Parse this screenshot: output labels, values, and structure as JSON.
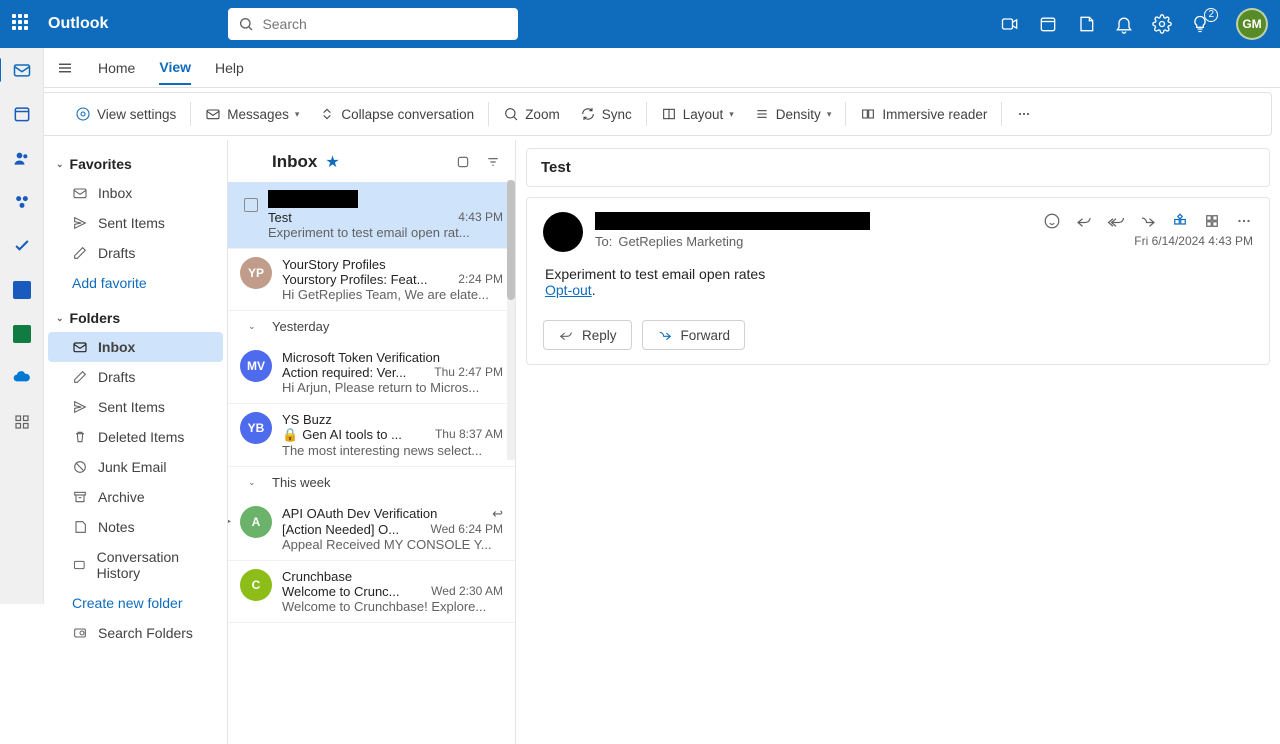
{
  "brand": "Outlook",
  "search_placeholder": "Search",
  "avatar_initials": "GM",
  "notif_badge": "2",
  "tabs": {
    "home": "Home",
    "view": "View",
    "help": "Help"
  },
  "toolbar": {
    "view_settings": "View settings",
    "messages": "Messages",
    "collapse": "Collapse conversation",
    "zoom": "Zoom",
    "sync": "Sync",
    "layout": "Layout",
    "density": "Density",
    "immersive": "Immersive reader"
  },
  "folders": {
    "favorites": "Favorites",
    "folders": "Folders",
    "items": {
      "inbox": "Inbox",
      "sent": "Sent Items",
      "drafts": "Drafts",
      "addfav": "Add favorite",
      "deleted": "Deleted Items",
      "junk": "Junk Email",
      "archive": "Archive",
      "notes": "Notes",
      "convhist": "Conversation History",
      "create": "Create new folder",
      "searchf": "Search Folders"
    }
  },
  "list": {
    "title": "Inbox",
    "msgs": [
      {
        "from": "",
        "subject": "Test",
        "time": "4:43 PM",
        "preview": "Experiment to test email open rat...",
        "avatar": "",
        "color": "#000",
        "selected": true,
        "redacted": true
      },
      {
        "from": "YourStory Profiles",
        "subject": "Yourstory Profiles: Feat...",
        "time": "2:24 PM",
        "preview": "Hi GetReplies Team, We are elate...",
        "avatar": "YP",
        "color": "#c19c8b"
      }
    ],
    "day_yesterday": "Yesterday",
    "msgs2": [
      {
        "from": "Microsoft Token Verification",
        "subject": "Action required: Ver...",
        "time": "Thu 2:47 PM",
        "preview": "Hi Arjun, Please return to Micros...",
        "avatar": "MV",
        "color": "#4f6bed"
      },
      {
        "from": "YS Buzz",
        "subject": "Gen AI tools to ...",
        "time": "Thu 8:37 AM",
        "preview": "The most interesting news select...",
        "avatar": "YB",
        "color": "#4f6bed",
        "lock": true
      }
    ],
    "day_thisweek": "This week",
    "msgs3": [
      {
        "from": "API OAuth Dev Verification",
        "subject": "[Action Needed] O...",
        "time": "Wed 6:24 PM",
        "preview": "Appeal Received MY CONSOLE Y...",
        "avatar": "A",
        "color": "#4f9e4f",
        "reply": true,
        "thread": true
      },
      {
        "from": "Crunchbase",
        "subject": "Welcome to Crunc...",
        "time": "Wed 2:30 AM",
        "preview": "Welcome to Crunchbase! Explore...",
        "avatar": "C",
        "color": "#8cbd18"
      }
    ]
  },
  "read": {
    "subject": "Test",
    "to_label": "To:",
    "to_value": "GetReplies Marketing",
    "date": "Fri 6/14/2024 4:43 PM",
    "body_line": "Experiment to test email open rates",
    "optout": "Opt-out",
    "reply": "Reply",
    "forward": "Forward"
  }
}
